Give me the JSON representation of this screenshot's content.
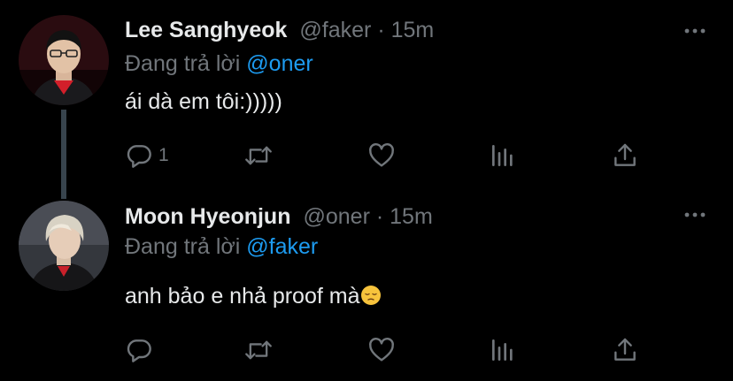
{
  "tweets": [
    {
      "name": "Lee Sanghyeok",
      "handle": "@faker",
      "separator": "·",
      "time": "15m",
      "reply_prefix": "Đang trả lời",
      "reply_to": "@oner",
      "text": "ái dà em tôi:)))))",
      "reply_count": "1"
    },
    {
      "name": "Moon Hyeonjun",
      "handle": "@oner",
      "separator": "·",
      "time": "15m",
      "reply_prefix": "Đang trả lời",
      "reply_to": "@faker",
      "text": "anh bảo e nhả proof mà",
      "emoji": "pensive-face"
    }
  ],
  "colors": {
    "background": "#000000",
    "primary_text": "#e7e9ea",
    "secondary_text": "#71767b",
    "mention": "#1d9bf0",
    "thread_line": "#38444d"
  },
  "icons": [
    "reply-icon",
    "retweet-icon",
    "like-icon",
    "stats-icon",
    "share-icon",
    "more-icon"
  ]
}
